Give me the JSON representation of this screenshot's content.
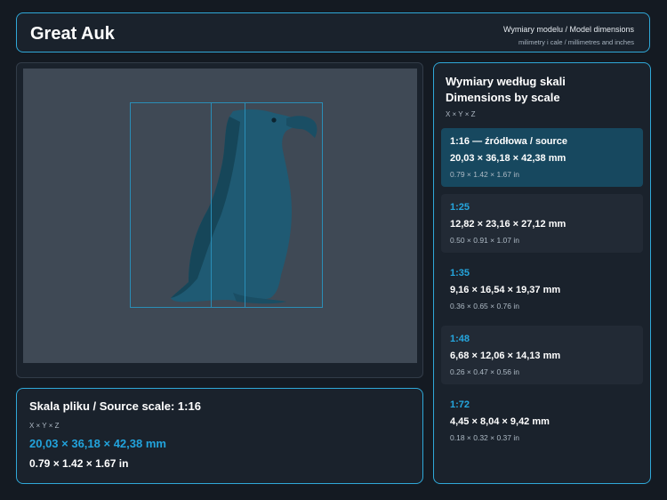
{
  "header": {
    "model_name": "Great Auk",
    "title": "Wymiary modelu / Model dimensions",
    "subtitle": "milimetry i cale / millimetres and inches"
  },
  "source": {
    "title": "Skala pliku / Source scale: 1:16",
    "axes": "X × Y × Z",
    "mm": "20,03 × 36,18 × 42,38 mm",
    "inches": "0.79 × 1.42 × 1.67 in"
  },
  "scales": {
    "title_line1": "Wymiary według skali",
    "title_line2": "Dimensions by scale",
    "axes": "X × Y × Z",
    "items": [
      {
        "ratio": "1:16  —  źródłowa / source",
        "mm": "20,03 × 36,18 × 42,38 mm",
        "inches": "0.79 × 1.42 × 1.67 in",
        "selected": true
      },
      {
        "ratio": "1:25",
        "mm": "12,82 × 23,16 × 27,12 mm",
        "inches": "0.50 × 0.91 × 1.07 in",
        "selected": false
      },
      {
        "ratio": "1:35",
        "mm": "9,16 × 16,54 × 19,37 mm",
        "inches": "0.36 × 0.65 × 0.76 in",
        "selected": false
      },
      {
        "ratio": "1:48",
        "mm": "6,68 × 12,06 × 14,13 mm",
        "inches": "0.26 × 0.47 × 0.56 in",
        "selected": false
      },
      {
        "ratio": "1:72",
        "mm": "4,45 × 8,04 × 9,42 mm",
        "inches": "0.18 × 0.32 × 0.37 in",
        "selected": false
      }
    ]
  },
  "colors": {
    "accent": "#2fa8d8",
    "background": "#141a22",
    "panel": "#1a222c",
    "viewport": "#3f4955",
    "model": "#1f5a73",
    "selected_card": "#17485f"
  }
}
